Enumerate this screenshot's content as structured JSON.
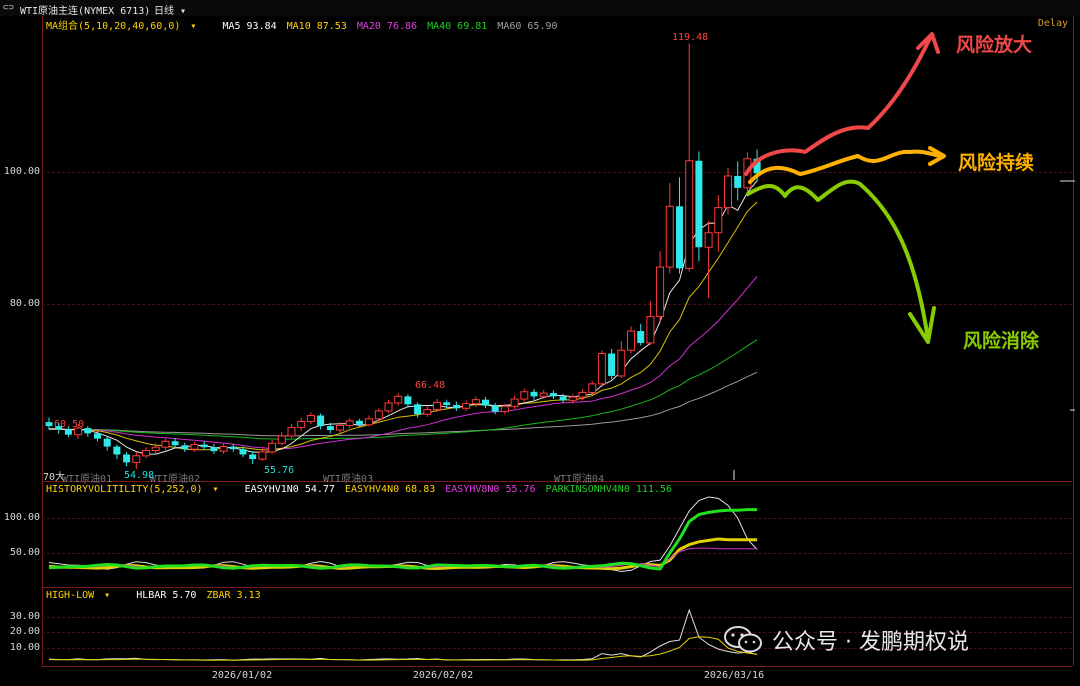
{
  "header": {
    "symbol": "WTI原油主连(NYMEX 6713)",
    "period": "日线",
    "period_icon": "chevron-down-icon",
    "delay": "Delay"
  },
  "ma_legend": {
    "title": "MA组合(5,10,20,40,60,0)",
    "items": [
      {
        "label": "MA5 93.84",
        "color": "#ffffff"
      },
      {
        "label": "MA10 87.53",
        "color": "#ffd200"
      },
      {
        "label": "MA20 76.86",
        "color": "#e040e0"
      },
      {
        "label": "MA40 69.81",
        "color": "#20d020"
      },
      {
        "label": "MA60 65.90",
        "color": "#a0a0a0"
      }
    ]
  },
  "hv_legend": {
    "title": "HISTORYVOLITILITY(5,252,0)",
    "items": [
      {
        "label": "EASYHV1N0 54.77",
        "color": "#ffffff"
      },
      {
        "label": "EASYHV4N0 68.83",
        "color": "#ffd200"
      },
      {
        "label": "EASYHV8N0 55.76",
        "color": "#e040e0"
      },
      {
        "label": "PARKINSONHV4N0 111.56",
        "color": "#20d020"
      }
    ]
  },
  "hl_legend": {
    "title": "HIGH-LOW",
    "items": [
      {
        "label": "HLBAR 5.70",
        "color": "#ffffff"
      },
      {
        "label": "ZBAR 3.13",
        "color": "#ffd200"
      }
    ]
  },
  "price_axis": [
    "100.00",
    "80.00"
  ],
  "hv_axis": [
    "100.00",
    "50.00"
  ],
  "hl_axis": [
    "30.00",
    "20.00",
    "10.00"
  ],
  "x_axis": [
    "2026/01/02",
    "2026/02/02",
    "2026/03/16"
  ],
  "contract_labels": [
    "70大",
    "WTI原油01",
    "WTI原油02",
    "WTI原油03",
    "WTI原油04"
  ],
  "price_annotations": {
    "high": "119.48",
    "p1": "60.50",
    "p2": "54.98",
    "p3": "55.76",
    "p4": "66.48"
  },
  "scenarios": [
    {
      "label": "风险放大",
      "color": "#f04848"
    },
    {
      "label": "风险持续",
      "color": "#ffb000"
    },
    {
      "label": "风险消除",
      "color": "#88cc00"
    }
  ],
  "watermark": "公众号 · 发鹏期权说",
  "chart_data": {
    "type": "candlestick",
    "ylim": [
      52,
      122
    ],
    "yticks": [
      80,
      100
    ],
    "candles": [
      [
        62.1,
        61.5,
        62.8,
        60.9
      ],
      [
        61.5,
        61.0,
        62.0,
        60.3
      ],
      [
        61.0,
        60.2,
        61.4,
        59.8
      ],
      [
        60.2,
        61.2,
        61.8,
        59.6
      ],
      [
        61.2,
        60.4,
        61.5,
        59.9
      ],
      [
        60.4,
        59.6,
        60.8,
        59.2
      ],
      [
        59.6,
        58.4,
        59.9,
        57.8
      ],
      [
        58.4,
        57.2,
        58.7,
        56.5
      ],
      [
        57.2,
        56.0,
        57.6,
        55.4
      ],
      [
        56.0,
        57.0,
        57.5,
        54.98
      ],
      [
        57.0,
        57.8,
        58.3,
        56.6
      ],
      [
        57.8,
        58.3,
        58.9,
        57.3
      ],
      [
        58.3,
        59.2,
        59.6,
        57.9
      ],
      [
        59.2,
        58.6,
        59.7,
        58.1
      ],
      [
        58.6,
        58.0,
        59.0,
        57.6
      ],
      [
        58.0,
        58.7,
        59.1,
        57.6
      ],
      [
        58.7,
        58.3,
        59.2,
        57.9
      ],
      [
        58.3,
        57.7,
        58.8,
        57.3
      ],
      [
        57.7,
        58.4,
        58.9,
        57.3
      ],
      [
        58.4,
        58.0,
        58.8,
        57.6
      ],
      [
        58.0,
        57.2,
        58.4,
        56.8
      ],
      [
        57.2,
        56.5,
        57.7,
        55.76
      ],
      [
        56.5,
        57.6,
        58.1,
        56.2
      ],
      [
        57.6,
        58.9,
        59.4,
        57.3
      ],
      [
        58.9,
        60.0,
        60.6,
        58.6
      ],
      [
        60.0,
        61.3,
        61.8,
        59.7
      ],
      [
        61.3,
        62.2,
        62.8,
        60.8
      ],
      [
        62.2,
        63.1,
        63.6,
        61.8
      ],
      [
        63.1,
        61.5,
        63.4,
        61.0
      ],
      [
        61.5,
        60.9,
        62.0,
        60.4
      ],
      [
        60.9,
        61.6,
        62.1,
        60.5
      ],
      [
        61.6,
        62.3,
        62.7,
        61.2
      ],
      [
        62.3,
        61.7,
        62.6,
        61.3
      ],
      [
        61.7,
        62.6,
        63.1,
        61.4
      ],
      [
        62.6,
        63.8,
        64.2,
        62.3
      ],
      [
        63.8,
        65.0,
        65.5,
        63.4
      ],
      [
        65.0,
        66.0,
        66.48,
        64.6
      ],
      [
        66.0,
        64.8,
        66.3,
        64.3
      ],
      [
        64.8,
        63.3,
        65.1,
        62.8
      ],
      [
        63.3,
        64.0,
        64.6,
        62.9
      ],
      [
        64.0,
        65.1,
        65.6,
        63.6
      ],
      [
        65.1,
        64.7,
        65.5,
        64.2
      ],
      [
        64.7,
        64.2,
        65.2,
        63.8
      ],
      [
        64.2,
        64.9,
        65.4,
        63.8
      ],
      [
        64.9,
        65.5,
        66.0,
        64.4
      ],
      [
        65.5,
        64.6,
        65.9,
        64.2
      ],
      [
        64.6,
        63.7,
        65.0,
        63.3
      ],
      [
        63.7,
        64.5,
        64.9,
        63.3
      ],
      [
        64.5,
        65.6,
        66.1,
        64.1
      ],
      [
        65.6,
        66.7,
        67.2,
        65.2
      ],
      [
        66.7,
        66.0,
        67.1,
        65.5
      ],
      [
        66.0,
        66.5,
        67.0,
        65.6
      ],
      [
        66.5,
        66.0,
        66.9,
        65.6
      ],
      [
        66.0,
        65.4,
        66.4,
        65.0
      ],
      [
        65.4,
        65.9,
        66.3,
        64.9
      ],
      [
        65.9,
        66.6,
        67.1,
        65.4
      ],
      [
        66.6,
        67.9,
        68.4,
        66.2
      ],
      [
        67.9,
        72.5,
        73.0,
        67.4
      ],
      [
        72.5,
        69.1,
        73.2,
        68.6
      ],
      [
        69.1,
        73.0,
        74.4,
        68.8
      ],
      [
        73.0,
        75.9,
        76.6,
        72.5
      ],
      [
        75.9,
        74.1,
        77.0,
        73.7
      ],
      [
        74.1,
        78.1,
        80.4,
        73.8
      ],
      [
        78.1,
        85.6,
        88.0,
        77.3
      ],
      [
        85.6,
        94.8,
        98.3,
        84.6
      ],
      [
        94.8,
        85.4,
        99.2,
        84.6
      ],
      [
        85.4,
        101.7,
        119.48,
        84.9
      ],
      [
        101.7,
        88.6,
        103.1,
        86.5
      ],
      [
        88.6,
        90.8,
        92.6,
        80.9
      ],
      [
        90.8,
        94.6,
        96.5,
        87.9
      ],
      [
        94.6,
        99.4,
        100.6,
        93.6
      ],
      [
        99.4,
        97.6,
        101.6,
        95.7
      ],
      [
        97.6,
        102.0,
        103.0,
        96.3
      ],
      [
        102.0,
        99.8,
        103.4,
        98.5
      ]
    ],
    "ma5_last": 93.84,
    "ma10_last": 87.53,
    "ma20_last": 76.86,
    "ma40_last": 69.81,
    "ma60_last": 65.9,
    "hv_ylim": [
      10,
      160
    ],
    "hl_ylim": [
      0,
      40
    ]
  }
}
